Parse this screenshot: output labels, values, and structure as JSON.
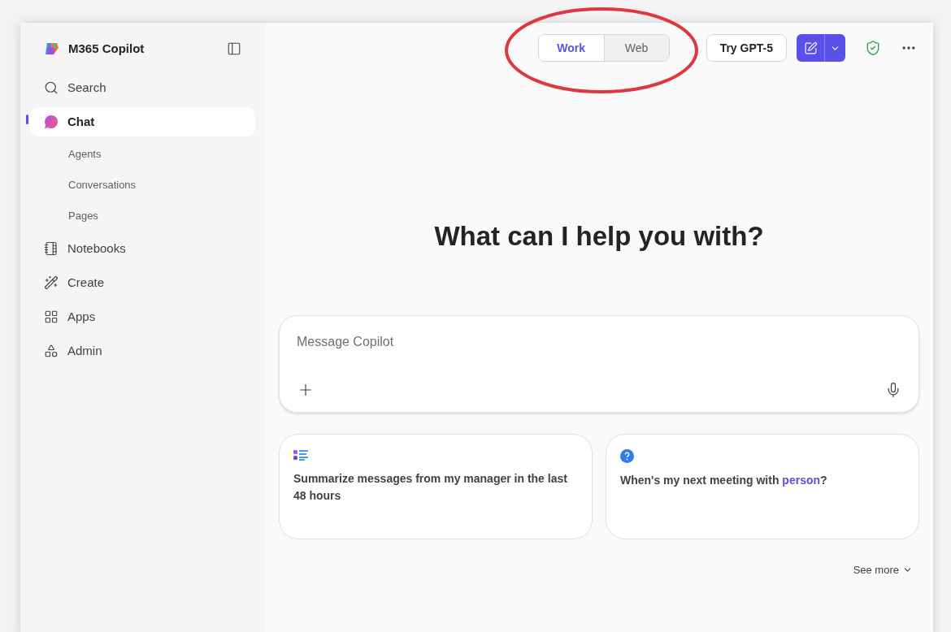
{
  "sidebar": {
    "title": "M365 Copilot",
    "items": [
      {
        "label": "Search",
        "kind": "search",
        "selected": false
      },
      {
        "label": "Chat",
        "kind": "chat",
        "selected": true,
        "children": [
          {
            "label": "Agents"
          },
          {
            "label": "Conversations"
          },
          {
            "label": "Pages"
          }
        ]
      },
      {
        "label": "Notebooks",
        "kind": "notebook",
        "selected": false
      },
      {
        "label": "Create",
        "kind": "create",
        "selected": false
      },
      {
        "label": "Apps",
        "kind": "apps",
        "selected": false
      },
      {
        "label": "Admin",
        "kind": "admin",
        "selected": false
      }
    ]
  },
  "toolbar": {
    "modes": [
      {
        "label": "Work",
        "selected": true
      },
      {
        "label": "Web",
        "selected": false
      }
    ],
    "try_button": "Try GPT-5"
  },
  "heading": "What can I help you with?",
  "composer": {
    "placeholder": "Message Copilot"
  },
  "suggestions": [
    {
      "kind": "list",
      "segments": [
        {
          "text": "Summarize messages from my manager in the last 48 hours",
          "kind": "plain"
        }
      ]
    },
    {
      "kind": "question",
      "segments": [
        {
          "text": "When's my next meeting with ",
          "kind": "plain"
        },
        {
          "text": "person",
          "kind": "variable"
        },
        {
          "text": "?",
          "kind": "plain"
        }
      ]
    }
  ],
  "see_more": "See more"
}
